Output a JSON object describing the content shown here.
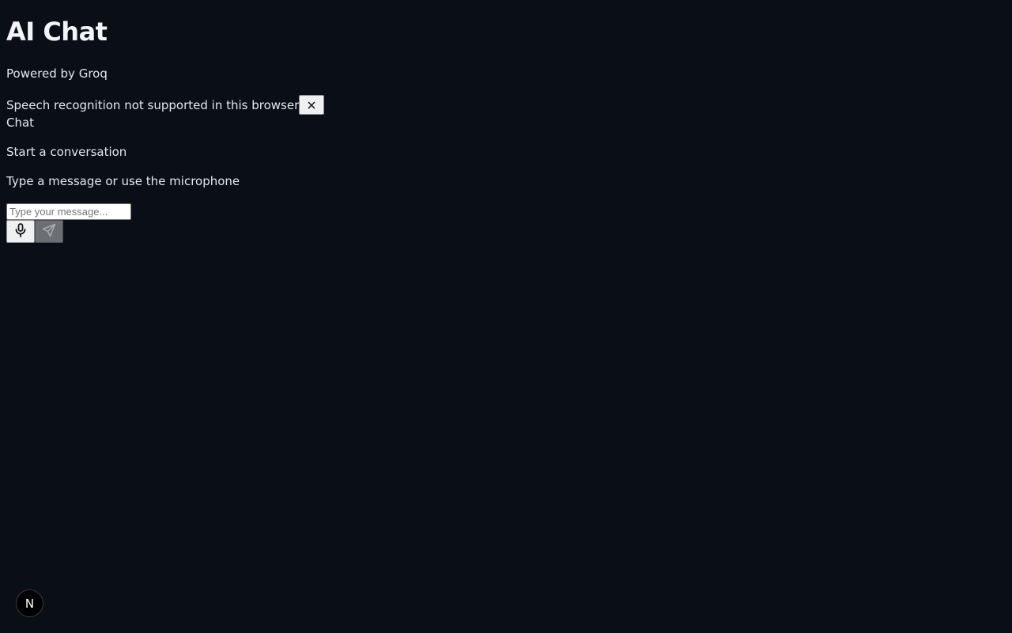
{
  "header": {
    "title": "AI Chat",
    "subtitle": "Powered by Groq"
  },
  "alert": {
    "message": "Speech recognition not supported in this browser",
    "close_icon": "close-icon"
  },
  "chat": {
    "label": "Chat",
    "empty_title": "Start a conversation",
    "empty_subtitle": "Type a message or use the microphone"
  },
  "composer": {
    "input_value": "",
    "input_placeholder": "Type your message...",
    "mic_icon": "microphone-icon",
    "send_icon": "send-icon",
    "send_disabled": true
  },
  "devtools": {
    "badge_letter": "N"
  },
  "colors": {
    "background": "#0a0e17",
    "text": "#e5e7eb",
    "button_bg": "#eff0f1",
    "send_disabled_bg": "#6b6e73"
  }
}
